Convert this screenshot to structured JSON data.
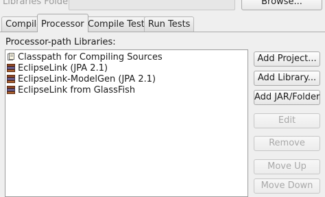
{
  "top": {
    "folder_label": "Libraries Folder:",
    "folder_value": "",
    "browse_label": "Browse..."
  },
  "tabs": [
    {
      "label": "Compile",
      "active": false
    },
    {
      "label": "Processor",
      "active": true
    },
    {
      "label": "Compile Tests",
      "active": false
    },
    {
      "label": "Run Tests",
      "active": false
    }
  ],
  "section_label": "Processor-path Libraries:",
  "libraries": [
    {
      "label": "Classpath for Compiling Sources",
      "icon": "classpath-icon"
    },
    {
      "label": "EclipseLink (JPA 2.1)",
      "icon": "library-icon"
    },
    {
      "label": "EclipseLink-ModelGen (JPA 2.1)",
      "icon": "library-icon"
    },
    {
      "label": "EclipseLink from GlassFish",
      "icon": "library-icon"
    }
  ],
  "buttons": {
    "add_project": "Add Project...",
    "add_library": "Add Library...",
    "add_jar": "Add JAR/Folder",
    "edit": "Edit",
    "remove": "Remove",
    "move_up": "Move Up",
    "move_down": "Move Down"
  }
}
